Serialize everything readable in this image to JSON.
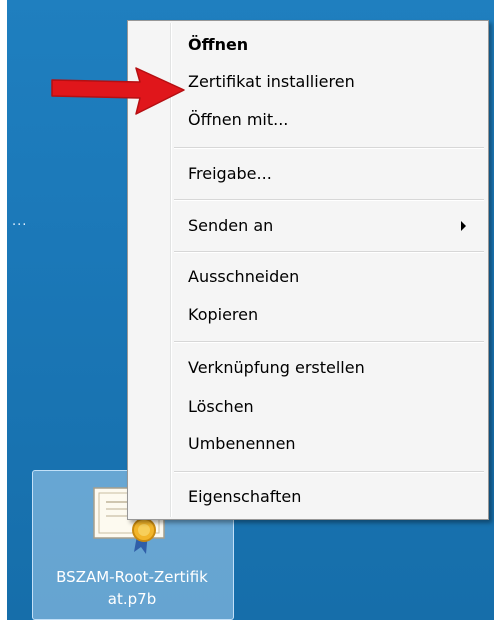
{
  "desktop": {
    "left_edge_text": "...",
    "file": {
      "name_line1": "BSZAM-Root-Zertifik",
      "name_line2": "at.p7b",
      "icon": "certificate-file-icon"
    }
  },
  "context_menu": {
    "items": [
      {
        "label": "Öffnen",
        "bold": true
      },
      {
        "label": "Zertifikat installieren"
      },
      {
        "label": "Öffnen mit..."
      },
      {
        "label": "Freigabe..."
      },
      {
        "label": "Senden an",
        "submenu": true
      },
      {
        "label": "Ausschneiden"
      },
      {
        "label": "Kopieren"
      },
      {
        "label": "Verknüpfung erstellen"
      },
      {
        "label": "Löschen"
      },
      {
        "label": "Umbenennen"
      },
      {
        "label": "Eigenschaften"
      }
    ],
    "submenu_icon": "chevron-right-icon"
  },
  "annotation": {
    "icon": "red-arrow-icon",
    "color": "#e0161b"
  },
  "colors": {
    "desktop_bg": "#1b78b8",
    "menu_bg": "#f5f5f5",
    "selection_tile": "#aad2f0"
  }
}
